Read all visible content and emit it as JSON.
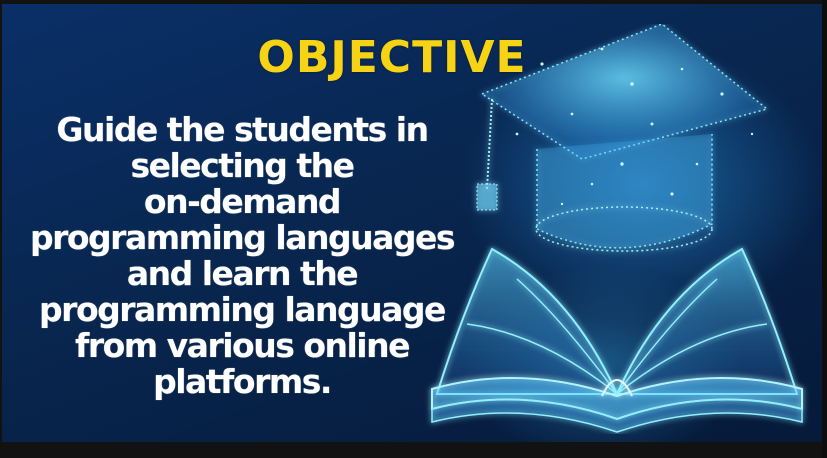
{
  "banner": {
    "title": "OBJECTIVE",
    "body_lines": [
      "Guide the students in",
      "selecting the",
      "on-demand",
      "programming languages",
      "and learn the",
      "programming language",
      "from various online",
      "platforms."
    ],
    "illustration_icons": [
      "graduation-cap-icon",
      "open-book-icon"
    ],
    "colors": {
      "title": "#f7d316",
      "text": "#ffffff",
      "background": "#0a2f68",
      "glow": "#4fd0ff"
    }
  }
}
